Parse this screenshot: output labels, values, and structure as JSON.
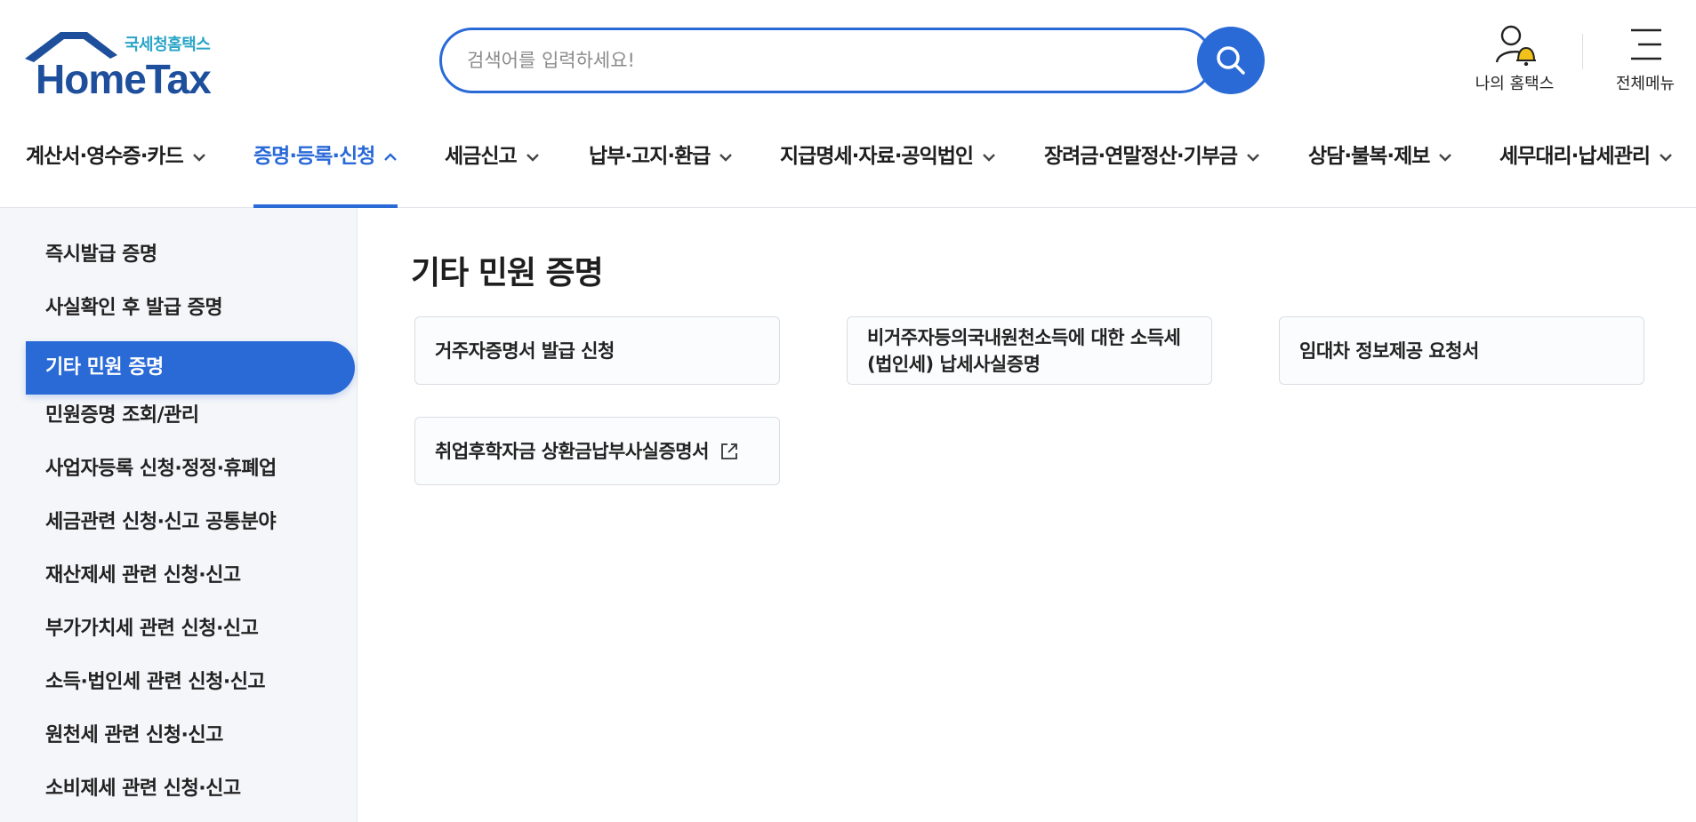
{
  "logo": {
    "sub": "국세청홈택스",
    "main": "HomeTax",
    "colors": {
      "house": "#1e4f9c",
      "sub": "#2aa4c7"
    }
  },
  "search": {
    "placeholder": "검색어를 입력하세요!",
    "value": "",
    "icon": "search-icon"
  },
  "utilities": {
    "my_hometax": {
      "label": "나의 홈택스",
      "icon": "user-bell-icon"
    },
    "all_menu": {
      "label": "전체메뉴",
      "icon": "hamburger-icon"
    }
  },
  "gnb": {
    "items": [
      {
        "label": "계산서·영수증·카드",
        "state": "collapsed"
      },
      {
        "label": "증명·등록·신청",
        "state": "expanded",
        "active": true
      },
      {
        "label": "세금신고",
        "state": "collapsed"
      },
      {
        "label": "납부·고지·환급",
        "state": "collapsed"
      },
      {
        "label": "지급명세·자료·공익법인",
        "state": "collapsed"
      },
      {
        "label": "장려금·연말정산·기부금",
        "state": "collapsed"
      },
      {
        "label": "상담·불복·제보",
        "state": "collapsed"
      },
      {
        "label": "세무대리·납세관리",
        "state": "collapsed"
      }
    ]
  },
  "sidebar": {
    "items": [
      {
        "label": "즉시발급 증명"
      },
      {
        "label": "사실확인 후 발급 증명"
      },
      {
        "label": "기타 민원 증명",
        "active": true
      },
      {
        "label": "민원증명 조회/관리"
      },
      {
        "label": "사업자등록 신청·정정·휴폐업"
      },
      {
        "label": "세금관련 신청·신고 공통분야"
      },
      {
        "label": "재산제세 관련 신청·신고"
      },
      {
        "label": "부가가치세 관련 신청·신고"
      },
      {
        "label": "소득·법인세 관련 신청·신고"
      },
      {
        "label": "원천세 관련 신청·신고"
      },
      {
        "label": "소비제세 관련 신청·신고"
      }
    ]
  },
  "content": {
    "title": "기타 민원 증명",
    "cards": [
      {
        "label": "거주자증명서 발급 신청"
      },
      {
        "label": "비거주자등의국내원천소득에 대한 소득세(법인세) 납세사실증명"
      },
      {
        "label": "임대차 정보제공 요청서"
      },
      {
        "label": "취업후학자금 상환금납부사실증명서",
        "icon": "external-link-icon"
      }
    ]
  },
  "colors": {
    "accent": "#2a6ad7",
    "sidebar_bg": "#f5f6f9",
    "bell": "#f2c21b"
  }
}
